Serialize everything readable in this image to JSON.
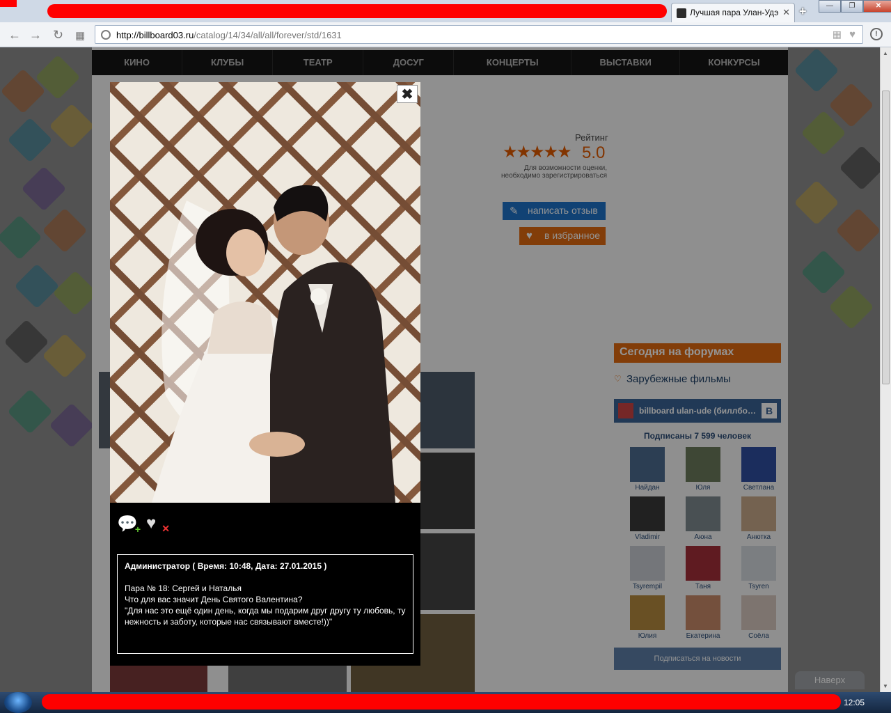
{
  "browser": {
    "tab_title": "Лучшая пара Улан-Удэ",
    "url_host": "http://billboard03.ru",
    "url_path": "/catalog/14/34/all/all/forever/std/1631"
  },
  "menu": [
    "КИНО",
    "КЛУБЫ",
    "ТЕАТР",
    "ДОСУГ",
    "КОНЦЕРТЫ",
    "ВЫСТАВКИ",
    "КОНКУРСЫ"
  ],
  "rating": {
    "label": "Рейтинг",
    "stars": "★★★★★",
    "value": "5.0",
    "note": "Для возможности оценки, необходимо зарегистрироваться"
  },
  "actions": {
    "review": "написать отзыв",
    "favorite": "в избранное"
  },
  "forum": {
    "title": "Сегодня на форумах",
    "link": "Зарубежные фильмы"
  },
  "vk": {
    "group": "billboard ulan-ude (биллбо…",
    "logo": "В",
    "subscribers": "Подписаны 7 599 человек",
    "friends": [
      "Найдан",
      "Юля",
      "Светлана",
      "Vladimir",
      "Аюна",
      "Анютка",
      "Tsyrempil",
      "Таня",
      "Tsyren",
      "Юлия",
      "Екатерина",
      "Соёла"
    ],
    "friend_colors": [
      "#4c6c90",
      "#6b7a5c",
      "#2f4ea0",
      "#3a3a3a",
      "#7f8a90",
      "#c9a98a",
      "#c9ccd2",
      "#a4303a",
      "#d5d9de",
      "#b58a3e",
      "#c98a6a",
      "#d8c8c0"
    ],
    "subscribe": "Подписаться на новости"
  },
  "lightbox": {
    "close": "✖",
    "comment": {
      "author": "Администратор ( Время: 10:48, Дата: 27.01.2015 )",
      "line1": "Пара № 18: Сергей и Наталья",
      "line2": "Что для вас значит День Святого Валентина?",
      "line3": "\"Для нас это ещё один день, когда мы подарим друг другу ту любовь, ту нежность и заботу, которые нас связывают вместе!))\""
    }
  },
  "scroll_top": "Наверх",
  "clock": "12:05",
  "colors": {
    "accent_orange": "#e06a10",
    "accent_blue": "#1e73c8",
    "vk_blue": "#3a6294",
    "menu_bg": "#151515"
  }
}
